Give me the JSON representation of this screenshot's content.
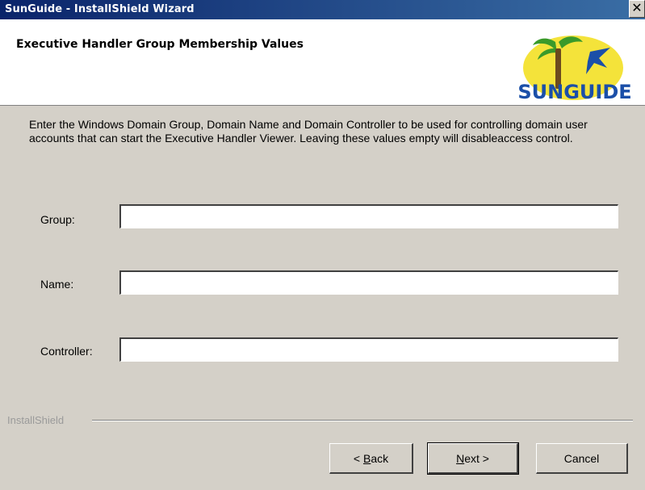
{
  "window": {
    "title": "SunGuide - InstallShield Wizard",
    "close_glyph": "✕"
  },
  "header": {
    "title": "Executive Handler Group Membership Values",
    "logo_text": "SUNGUIDE",
    "logo_icon": "sunguide-logo-icon"
  },
  "description": "Enter the Windows Domain Group, Domain Name and Domain Controller to be used for controlling domain user accounts that can start the Executive Handler Viewer. Leaving these values empty will disableaccess control.",
  "fields": {
    "group": {
      "label": "Group:",
      "value": ""
    },
    "name": {
      "label": "Name:",
      "value": ""
    },
    "controller": {
      "label": "Controller:",
      "value": ""
    }
  },
  "footer": {
    "brand": "InstallShield"
  },
  "buttons": {
    "back": {
      "prefix": "< ",
      "accel": "B",
      "rest": "ack"
    },
    "next": {
      "accel": "N",
      "rest": "ext >"
    },
    "cancel": {
      "label": "Cancel"
    }
  }
}
